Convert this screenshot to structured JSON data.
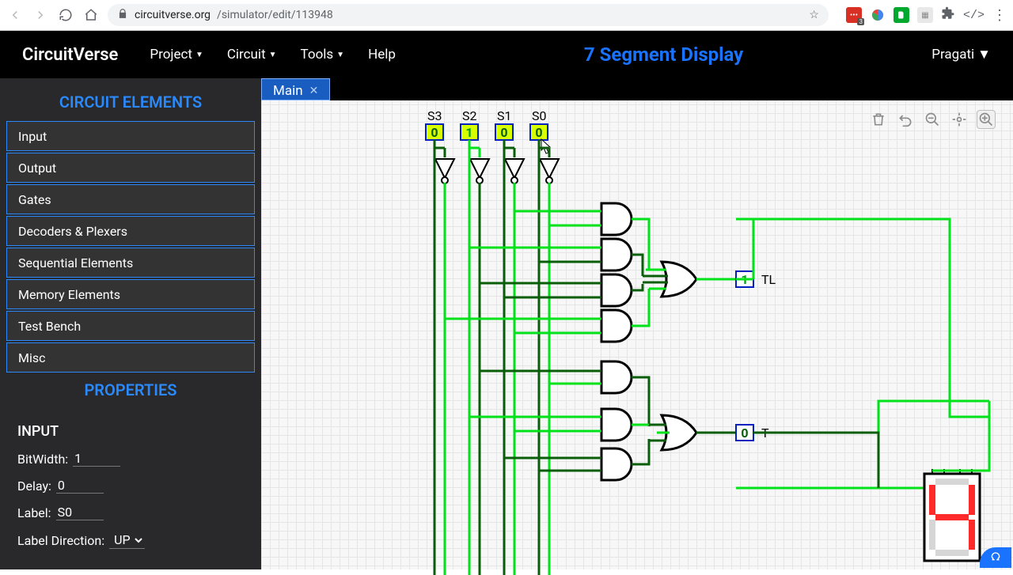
{
  "browser": {
    "url_host": "circuitverse.org",
    "url_path": "/simulator/edit/113948",
    "ext_badge": "3"
  },
  "app": {
    "brand": "CircuitVerse",
    "menu": [
      "Project",
      "Circuit",
      "Tools",
      "Help"
    ],
    "title": "7 Segment Display",
    "user": "Pragati"
  },
  "sidebar": {
    "elements_header": "CIRCUIT ELEMENTS",
    "categories": [
      "Input",
      "Output",
      "Gates",
      "Decoders & Plexers",
      "Sequential Elements",
      "Memory Elements",
      "Test Bench",
      "Misc"
    ],
    "properties_header": "PROPERTIES",
    "properties_title": "INPUT",
    "props": {
      "bitwidth_label": "BitWidth:",
      "bitwidth_value": "1",
      "delay_label": "Delay:",
      "delay_value": "0",
      "label_label": "Label:",
      "label_value": "S0",
      "labeldir_label": "Label Direction:",
      "labeldir_value": "UP"
    }
  },
  "tabs": {
    "main": "Main"
  },
  "inputs": {
    "s3": {
      "name": "S3",
      "value": "0"
    },
    "s2": {
      "name": "S2",
      "value": "1"
    },
    "s1": {
      "name": "S1",
      "value": "0"
    },
    "s0": {
      "name": "S0",
      "value": "0"
    }
  },
  "outputs": {
    "tl": {
      "name": "TL",
      "value": "1"
    },
    "t": {
      "name": "T",
      "value": "0"
    }
  },
  "colors": {
    "wire_on": "#00e21a",
    "wire_off": "#0a5e0a",
    "box_sel": "#d8ff00",
    "seg_on": "#ff2a2a",
    "seg_off": "#d6d6d6"
  }
}
